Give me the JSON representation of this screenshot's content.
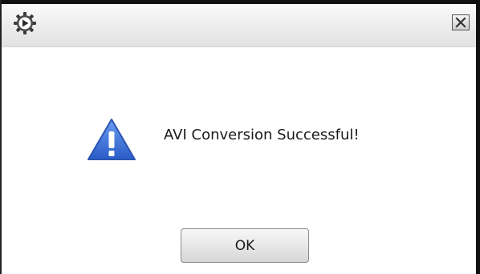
{
  "dialog": {
    "app_icon": "gear-play-icon",
    "close_icon": "close-icon",
    "warning_icon": "warning-triangle-icon",
    "message": "AVI Conversion Successful!",
    "ok_label": "OK"
  },
  "colors": {
    "warning_blue": "#3a6fd8",
    "border": "#111111"
  }
}
